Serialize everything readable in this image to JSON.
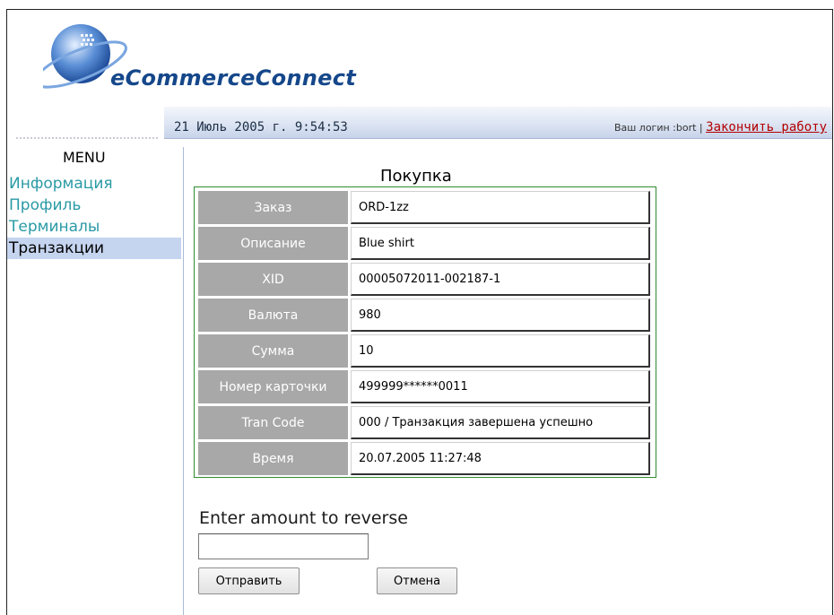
{
  "brand": {
    "name": "eCommerceConnect"
  },
  "header": {
    "date": "21 Июль 2005 г. 9:54:53",
    "login_label": "Ваш логин :bort",
    "separator": "|",
    "logout_label": "Закончить работу"
  },
  "sidebar": {
    "title": "MENU",
    "items": [
      {
        "label": "Информация"
      },
      {
        "label": "Профиль"
      },
      {
        "label": "Терминалы"
      },
      {
        "label": "Транзакции"
      }
    ]
  },
  "main": {
    "title": "Покупка",
    "details": [
      {
        "label": "Заказ",
        "value": "ORD-1zz"
      },
      {
        "label": "Описание",
        "value": "Blue shirt"
      },
      {
        "label": "XID",
        "value": "00005072011-002187-1"
      },
      {
        "label": "Валюта",
        "value": "980"
      },
      {
        "label": "Сумма",
        "value": "10"
      },
      {
        "label": "Номер карточки",
        "value": "499999******0011"
      },
      {
        "label": "Tran Code",
        "value": "000 / Транзакция завершена успешно"
      },
      {
        "label": "Время",
        "value": "20.07.2005 11:27:48"
      }
    ],
    "reverse": {
      "label": "Enter amount to reverse",
      "amount_value": "",
      "submit_label": "Отправить",
      "cancel_label": "Отмена"
    }
  },
  "colors": {
    "brand_blue": "#15478a",
    "menu_link": "#2a9aa5",
    "active_bg": "#c5d4ef",
    "table_border": "#2f8c2f",
    "label_bg": "#a8a8a8",
    "logout_red": "#b30000"
  }
}
